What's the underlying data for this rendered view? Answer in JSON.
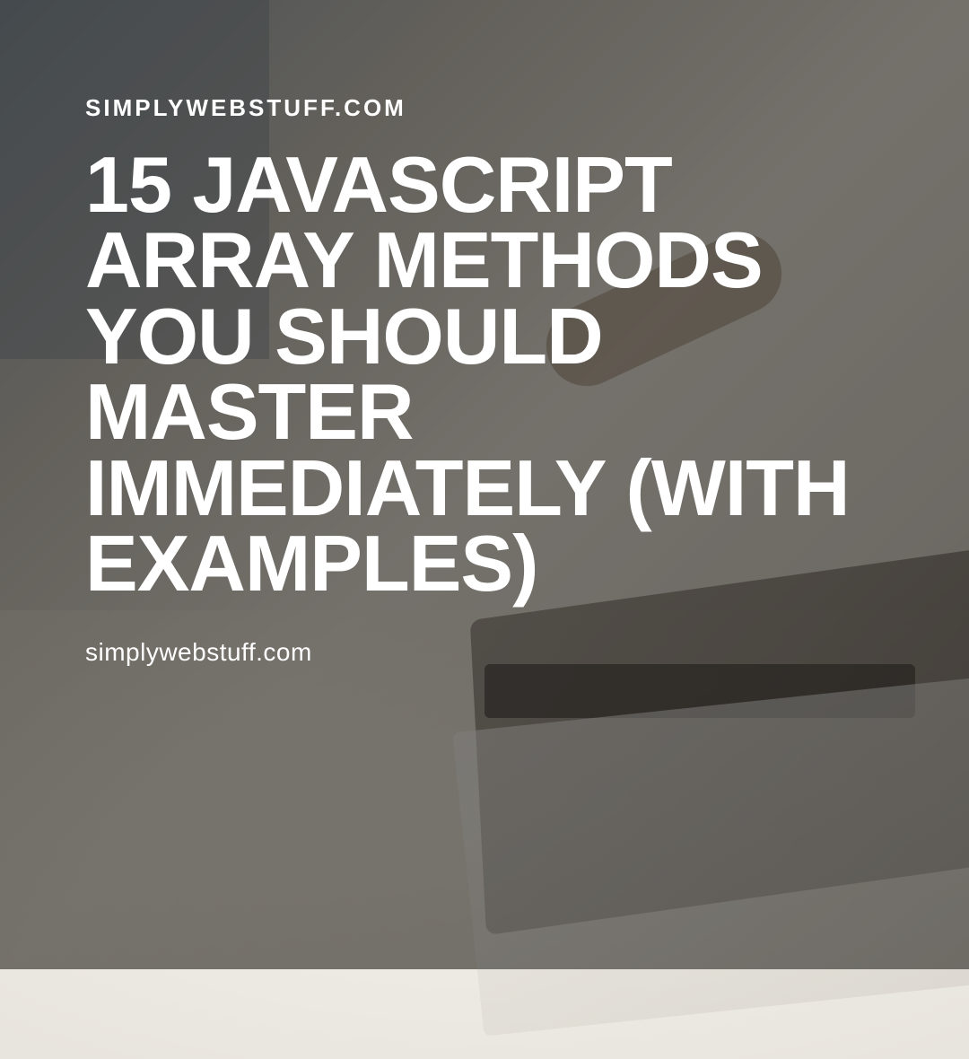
{
  "site_label": "SIMPLYWEBSTUFF.COM",
  "headline": "15 JAVASCRIPT ARRAY METHODS YOU SHOULD MASTER IMMEDIATELY (WITH EXAMPLES)",
  "site_url": "simplywebstuff.com"
}
